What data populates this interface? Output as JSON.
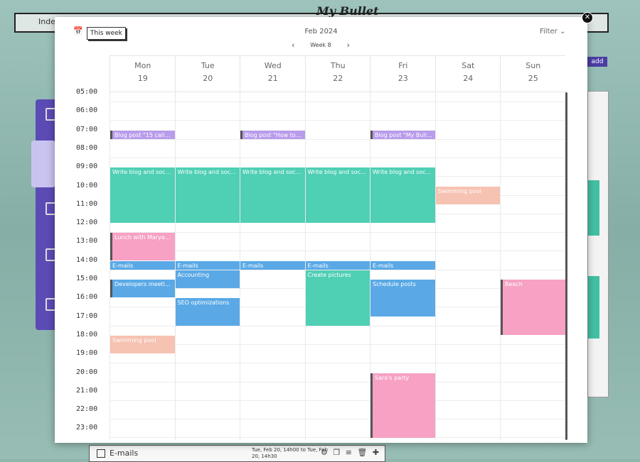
{
  "background": {
    "app_title": "My Bullet",
    "window_label": "Inde",
    "add_label": "add",
    "bottom_task": {
      "label": "E-mails",
      "date": "Tue, Feb 20, 14h00 to Tue, Feb 20, 14h30"
    }
  },
  "toolbar": {
    "this_week": "This week",
    "month": "Feb 2024",
    "week": "Week 8",
    "filter": "Filter"
  },
  "days": [
    {
      "name": "Mon",
      "date": "19"
    },
    {
      "name": "Tue",
      "date": "20"
    },
    {
      "name": "Wed",
      "date": "21"
    },
    {
      "name": "Thu",
      "date": "22"
    },
    {
      "name": "Fri",
      "date": "23"
    },
    {
      "name": "Sat",
      "date": "24"
    },
    {
      "name": "Sun",
      "date": "25"
    }
  ],
  "hours": [
    "05:00",
    "06:00",
    "07:00",
    "08:00",
    "09:00",
    "10:00",
    "11:00",
    "12:00",
    "13:00",
    "14:00",
    "15:00",
    "16:00",
    "17:00",
    "18:00",
    "19:00",
    "20:00",
    "21:00",
    "22:00",
    "23:00"
  ],
  "events": [
    {
      "title": "Blog post \"15 calle…",
      "day": 0,
      "start": 7,
      "end": 7.5,
      "color": "purple",
      "bar": true
    },
    {
      "title": "Blog post \"How to …",
      "day": 2,
      "start": 7,
      "end": 7.5,
      "color": "purple",
      "bar": true
    },
    {
      "title": "Blog post \"My Bulle…",
      "day": 4,
      "start": 7,
      "end": 7.5,
      "color": "purple",
      "bar": true
    },
    {
      "title": "Write blog and soc…",
      "day": 0,
      "start": 9,
      "end": 12,
      "color": "green",
      "bar": false
    },
    {
      "title": "Write blog and soc…",
      "day": 1,
      "start": 9,
      "end": 12,
      "color": "green",
      "bar": false
    },
    {
      "title": "Write blog and soc…",
      "day": 2,
      "start": 9,
      "end": 12,
      "color": "green",
      "bar": false
    },
    {
      "title": "Write blog and soc…",
      "day": 3,
      "start": 9,
      "end": 12,
      "color": "green",
      "bar": false
    },
    {
      "title": "Write blog and soc…",
      "day": 4,
      "start": 9,
      "end": 12,
      "color": "green",
      "bar": false
    },
    {
      "title": "Swimming pool",
      "day": 5,
      "start": 10,
      "end": 11,
      "color": "peach",
      "bar": false
    },
    {
      "title": "Lunch with Marya…",
      "day": 0,
      "start": 12.5,
      "end": 14,
      "color": "pink",
      "bar": true
    },
    {
      "title": "E-mails",
      "day": 0,
      "start": 14,
      "end": 14.5,
      "color": "blue",
      "bar": false
    },
    {
      "title": "E-mails",
      "day": 1,
      "start": 14,
      "end": 14.5,
      "color": "blue",
      "bar": false
    },
    {
      "title": "E-mails",
      "day": 2,
      "start": 14,
      "end": 14.5,
      "color": "blue",
      "bar": false
    },
    {
      "title": "E-mails",
      "day": 3,
      "start": 14,
      "end": 14.5,
      "color": "blue",
      "bar": false
    },
    {
      "title": "E-mails",
      "day": 4,
      "start": 14,
      "end": 14.5,
      "color": "blue",
      "bar": false
    },
    {
      "title": "Accounting",
      "day": 1,
      "start": 14.5,
      "end": 15.5,
      "color": "blue",
      "bar": false
    },
    {
      "title": "Create pictures",
      "day": 3,
      "start": 14.5,
      "end": 17.5,
      "color": "green",
      "bar": false
    },
    {
      "title": "Developers meeti…",
      "day": 0,
      "start": 15,
      "end": 16,
      "color": "blue",
      "bar": true
    },
    {
      "title": "Schedule posts",
      "day": 4,
      "start": 15,
      "end": 17,
      "color": "blue",
      "bar": false
    },
    {
      "title": "Beach",
      "day": 6,
      "start": 15,
      "end": 18,
      "color": "pink",
      "bar": true
    },
    {
      "title": "SEO optimizations",
      "day": 1,
      "start": 16,
      "end": 17.5,
      "color": "blue",
      "bar": false
    },
    {
      "title": "Swimming pool",
      "day": 0,
      "start": 18,
      "end": 19,
      "color": "peach",
      "bar": false
    },
    {
      "title": "Sara's party",
      "day": 4,
      "start": 20,
      "end": 23.5,
      "color": "pink",
      "bar": true
    }
  ]
}
